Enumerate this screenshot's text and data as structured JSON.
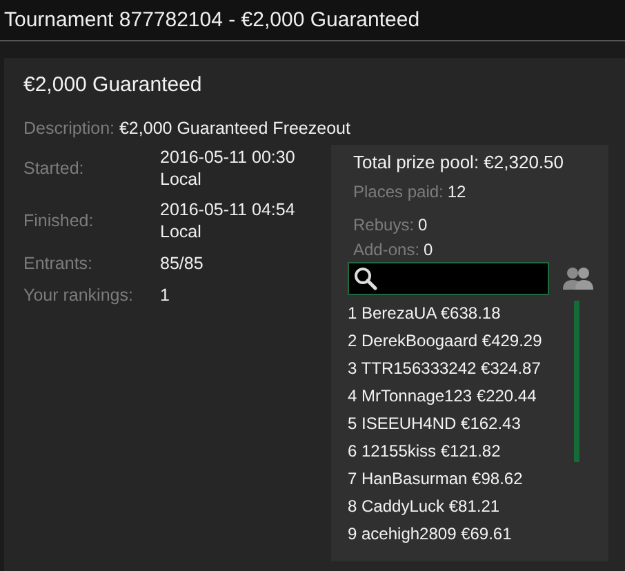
{
  "window": {
    "title": "Tournament 877782104 - €2,000 Guaranteed"
  },
  "heading": "€2,000 Guaranteed",
  "description": {
    "label": "Description:",
    "value": "€2,000 Guaranteed Freezeout"
  },
  "details": [
    {
      "label": "Started:",
      "value": "2016-05-11 00:30 Local"
    },
    {
      "label": "Finished:",
      "value": "2016-05-11 04:54 Local"
    },
    {
      "label": "Entrants:",
      "value": "85/85"
    },
    {
      "label": "Your rankings:",
      "value": "1"
    }
  ],
  "prize_panel": {
    "total": "Total prize pool: €2,320.50",
    "stats": [
      {
        "label": "Places paid:",
        "value": "12"
      },
      {
        "label": "Rebuys:",
        "value": "0"
      },
      {
        "label": "Add-ons:",
        "value": "0"
      }
    ],
    "payouts": [
      "1 BerezaUA €638.18",
      "2 DerekBoogaard €429.29",
      "3 TTR156333242 €324.87",
      "4 MrTonnage123 €220.44",
      "5 ISEEUH4ND €162.43",
      "6 12155kiss €121.82",
      "7 HanBasurman €98.62",
      "8 CaddyLuck €81.21",
      "9 acehigh2809 €69.61"
    ]
  }
}
